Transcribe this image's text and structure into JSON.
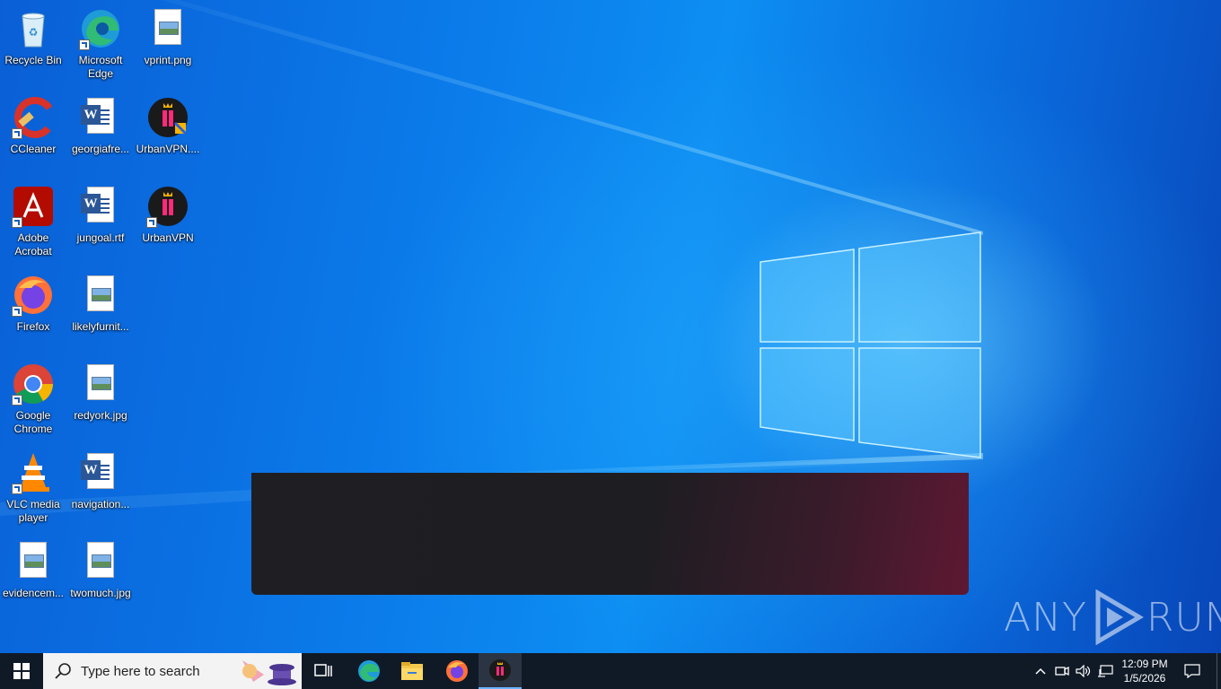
{
  "desktop": {
    "icons": [
      {
        "label": "Recycle Bin",
        "icon": "recycle-bin-icon"
      },
      {
        "label": "Microsoft Edge",
        "icon": "edge-icon"
      },
      {
        "label": "vprint.png",
        "icon": "image-file-icon"
      },
      {
        "label": "CCleaner",
        "icon": "ccleaner-icon"
      },
      {
        "label": "georgiafre...",
        "icon": "word-document-icon"
      },
      {
        "label": "UrbanVPN....",
        "icon": "urbanvpn-installer-icon"
      },
      {
        "label": "Adobe Acrobat",
        "icon": "acrobat-icon"
      },
      {
        "label": "jungoal.rtf",
        "icon": "word-document-icon"
      },
      {
        "label": "UrbanVPN",
        "icon": "urbanvpn-icon"
      },
      {
        "label": "Firefox",
        "icon": "firefox-icon"
      },
      {
        "label": "likelyfurnit...",
        "icon": "image-file-icon"
      },
      {
        "label": "Google Chrome",
        "icon": "chrome-icon"
      },
      {
        "label": "redyork.jpg",
        "icon": "image-file-icon"
      },
      {
        "label": "VLC media player",
        "icon": "vlc-icon"
      },
      {
        "label": "navigation...",
        "icon": "word-document-icon"
      },
      {
        "label": "evidencem...",
        "icon": "image-file-icon"
      },
      {
        "label": "twomuch.jpg",
        "icon": "image-file-icon"
      }
    ]
  },
  "watermark": {
    "text_left": "ANY",
    "text_right": "RUN"
  },
  "taskbar": {
    "search_placeholder": "Type here to search",
    "pinned": [
      "task-view-icon",
      "edge-icon",
      "file-explorer-icon",
      "firefox-icon",
      "urbanvpn-icon"
    ],
    "clock": {
      "time": "12:09 PM",
      "date": "1/5/2026"
    }
  }
}
